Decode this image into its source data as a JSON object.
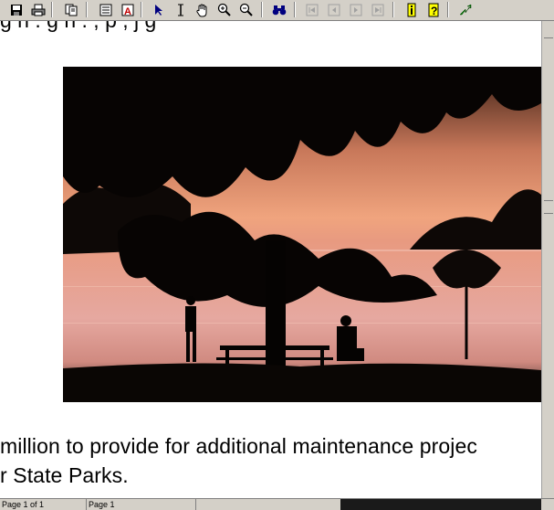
{
  "toolbar": {
    "buttons": [
      {
        "name": "save-icon",
        "label": "Save"
      },
      {
        "name": "print-icon",
        "label": "Print"
      },
      {
        "name": "copy-page-icon",
        "label": "Copy"
      },
      {
        "name": "page-layout-icon",
        "label": "Page layout"
      },
      {
        "name": "text-find-icon",
        "label": "Text"
      },
      {
        "name": "select-arrow-icon",
        "label": "Select"
      },
      {
        "name": "text-cursor-icon",
        "label": "Text select"
      },
      {
        "name": "hand-icon",
        "label": "Hand"
      },
      {
        "name": "zoom-in-icon",
        "label": "Zoom in"
      },
      {
        "name": "zoom-out-icon",
        "label": "Zoom out"
      },
      {
        "name": "binoculars-icon",
        "label": "Find"
      },
      {
        "name": "first-page-icon",
        "label": "First page"
      },
      {
        "name": "prev-page-icon",
        "label": "Previous page"
      },
      {
        "name": "next-page-icon",
        "label": "Next page"
      },
      {
        "name": "last-page-icon",
        "label": "Last page"
      },
      {
        "name": "info-icon",
        "label": "Info"
      },
      {
        "name": "help-icon",
        "label": "Help"
      },
      {
        "name": "go-arrow-icon",
        "label": "Go"
      }
    ]
  },
  "document": {
    "cut_line": "g   h   .        g   h    .     ,         p      ,     j   g",
    "line1": "million to provide for additional maintenance projec",
    "line2": "r State Parks."
  },
  "status": {
    "field1": "Page 1 of 1",
    "field2": "Page 1"
  },
  "colors": {
    "toolbar_bg": "#d4d0c8",
    "sky_top": "#2a1a12",
    "sky_glow": "#f2a07a",
    "water": "#e8a8a0"
  }
}
